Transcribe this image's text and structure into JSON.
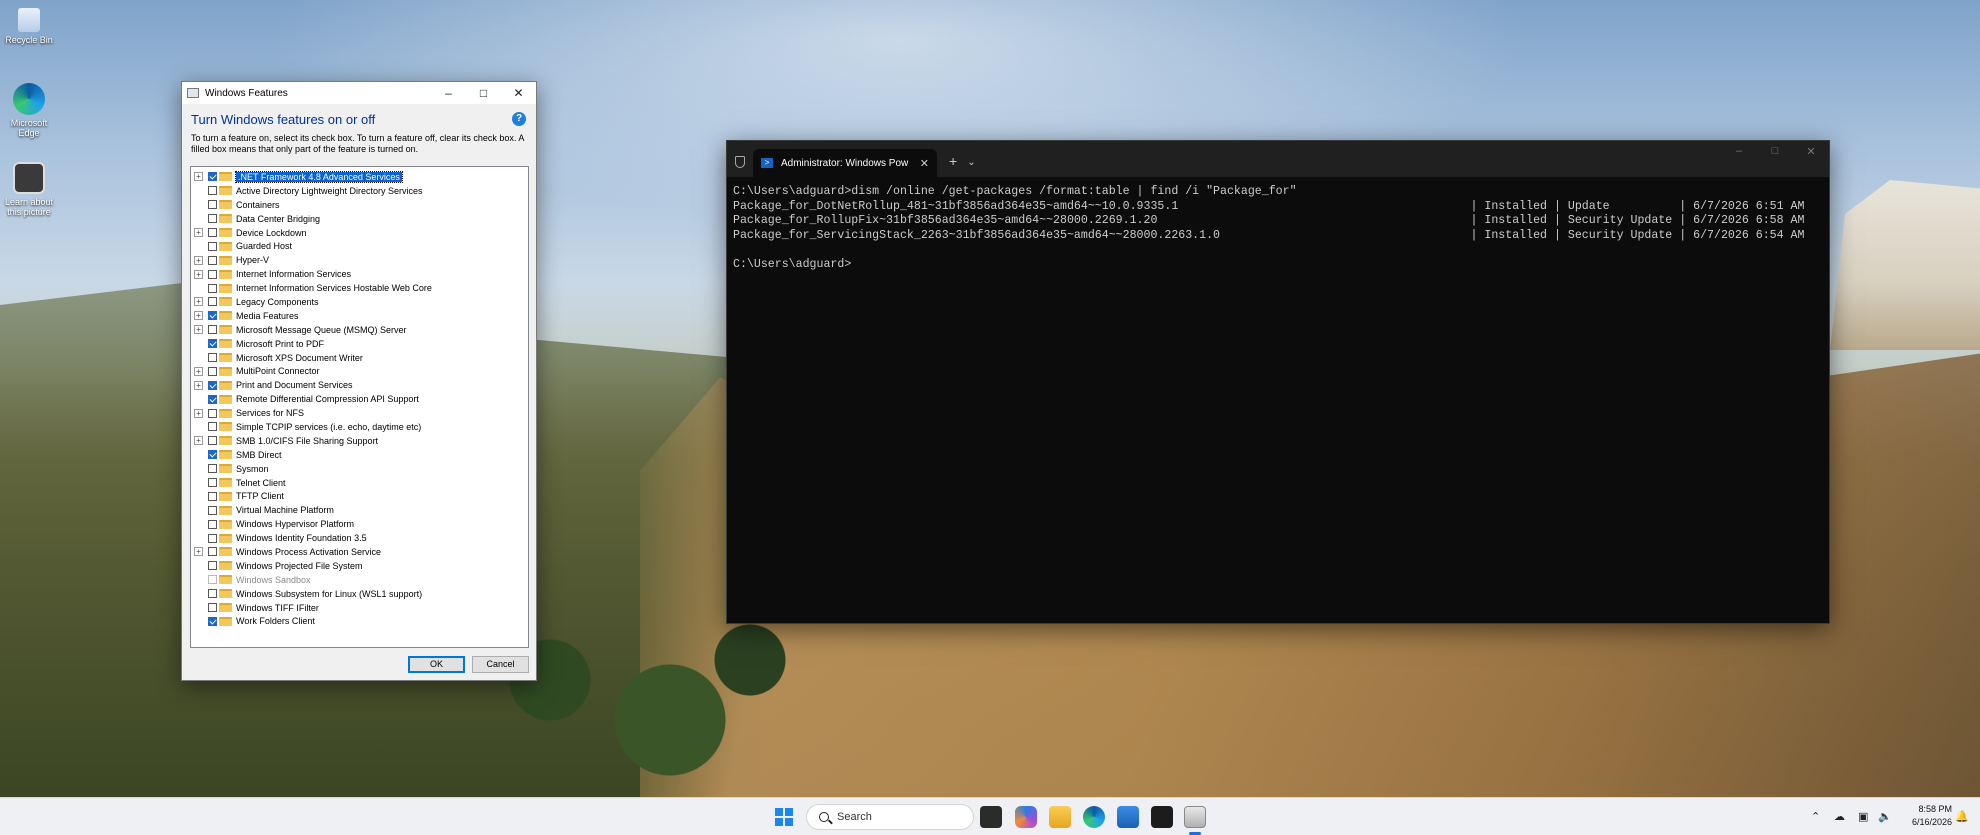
{
  "desktop": {
    "icons": [
      {
        "label": "Recycle Bin",
        "icon": "recycle-bin-icon"
      },
      {
        "label": "Microsoft Edge",
        "icon": "edge-icon"
      },
      {
        "label": "Learn about this picture",
        "icon": "learn-picture-icon"
      }
    ]
  },
  "windows_features": {
    "title": "Windows Features",
    "heading": "Turn Windows features on or off",
    "help": "?",
    "description": "To turn a feature on, select its check box. To turn a feature off, clear its check box. A filled box means that only part of the feature is turned on.",
    "ok_label": "OK",
    "cancel_label": "Cancel",
    "features": [
      {
        "label": ".NET Framework 4.8 Advanced Services",
        "expandable": true,
        "state": "partial",
        "selected": true
      },
      {
        "label": "Active Directory Lightweight Directory Services",
        "expandable": false,
        "state": "unchecked"
      },
      {
        "label": "Containers",
        "expandable": false,
        "state": "unchecked"
      },
      {
        "label": "Data Center Bridging",
        "expandable": false,
        "state": "unchecked"
      },
      {
        "label": "Device Lockdown",
        "expandable": true,
        "state": "unchecked"
      },
      {
        "label": "Guarded Host",
        "expandable": false,
        "state": "unchecked"
      },
      {
        "label": "Hyper-V",
        "expandable": true,
        "state": "unchecked"
      },
      {
        "label": "Internet Information Services",
        "expandable": true,
        "state": "unchecked"
      },
      {
        "label": "Internet Information Services Hostable Web Core",
        "expandable": false,
        "state": "unchecked"
      },
      {
        "label": "Legacy Components",
        "expandable": true,
        "state": "unchecked"
      },
      {
        "label": "Media Features",
        "expandable": true,
        "state": "checked"
      },
      {
        "label": "Microsoft Message Queue (MSMQ) Server",
        "expandable": true,
        "state": "unchecked"
      },
      {
        "label": "Microsoft Print to PDF",
        "expandable": false,
        "state": "checked"
      },
      {
        "label": "Microsoft XPS Document Writer",
        "expandable": false,
        "state": "unchecked"
      },
      {
        "label": "MultiPoint Connector",
        "expandable": true,
        "state": "unchecked"
      },
      {
        "label": "Print and Document Services",
        "expandable": true,
        "state": "partial"
      },
      {
        "label": "Remote Differential Compression API Support",
        "expandable": false,
        "state": "checked"
      },
      {
        "label": "Services for NFS",
        "expandable": true,
        "state": "unchecked"
      },
      {
        "label": "Simple TCPIP services (i.e. echo, daytime etc)",
        "expandable": false,
        "state": "unchecked"
      },
      {
        "label": "SMB 1.0/CIFS File Sharing Support",
        "expandable": true,
        "state": "unchecked"
      },
      {
        "label": "SMB Direct",
        "expandable": false,
        "state": "checked"
      },
      {
        "label": "Sysmon",
        "expandable": false,
        "state": "unchecked"
      },
      {
        "label": "Telnet Client",
        "expandable": false,
        "state": "unchecked"
      },
      {
        "label": "TFTP Client",
        "expandable": false,
        "state": "unchecked"
      },
      {
        "label": "Virtual Machine Platform",
        "expandable": false,
        "state": "unchecked"
      },
      {
        "label": "Windows Hypervisor Platform",
        "expandable": false,
        "state": "unchecked"
      },
      {
        "label": "Windows Identity Foundation 3.5",
        "expandable": false,
        "state": "unchecked"
      },
      {
        "label": "Windows Process Activation Service",
        "expandable": true,
        "state": "unchecked"
      },
      {
        "label": "Windows Projected File System",
        "expandable": false,
        "state": "unchecked"
      },
      {
        "label": "Windows Sandbox",
        "expandable": false,
        "state": "disabled"
      },
      {
        "label": "Windows Subsystem for Linux (WSL1 support)",
        "expandable": false,
        "state": "unchecked"
      },
      {
        "label": "Windows TIFF IFilter",
        "expandable": false,
        "state": "unchecked"
      },
      {
        "label": "Work Folders Client",
        "expandable": false,
        "state": "checked"
      }
    ]
  },
  "terminal": {
    "tab_title": "Administrator: Windows Pow",
    "lines": [
      "C:\\Users\\adguard>dism /online /get-packages /format:table | find /i \"Package_for\"",
      "Package_for_DotNetRollup_481~31bf3856ad364e35~amd64~~10.0.9335.1                                          | Installed | Update          | 6/7/2026 6:51 AM",
      "Package_for_RollupFix~31bf3856ad364e35~amd64~~28000.2269.1.20                                             | Installed | Security Update | 6/7/2026 6:58 AM",
      "Package_for_ServicingStack_2263~31bf3856ad364e35~amd64~~28000.2263.1.0                                    | Installed | Security Update | 6/7/2026 6:54 AM",
      "",
      "C:\\Users\\adguard>"
    ]
  },
  "taskbar": {
    "search_placeholder": "Search",
    "apps": [
      "file-explorer-dark-icon",
      "copilot-icon",
      "file-explorer-icon",
      "edge-icon",
      "store-icon",
      "terminal-icon",
      "features-icon"
    ],
    "tray_icons": [
      "chevron-up-icon",
      "cloud-icon",
      "network-icon",
      "volume-icon",
      "notification-icon"
    ],
    "time": "8:58 PM",
    "date": "6/16/2026"
  }
}
